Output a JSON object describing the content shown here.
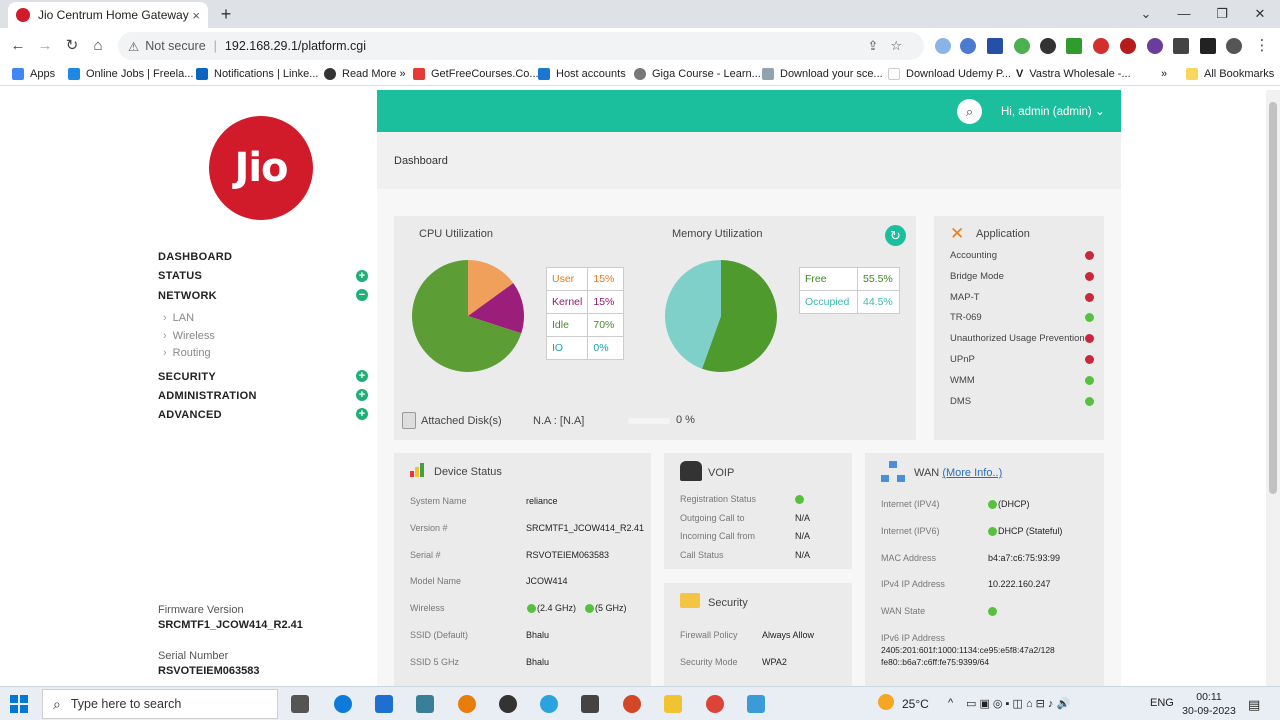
{
  "browser": {
    "tab_title": "Jio Centrum Home Gateway :",
    "tab_close": "×",
    "new_tab": "+",
    "security_label": "Not secure",
    "url": "192.168.29.1/platform.cgi",
    "bookmarks": [
      "Apps",
      "Online Jobs | Freela...",
      "Notifications | Linke...",
      "Read More »",
      "GetFreeCourses.Co...",
      "Host accounts",
      "Giga Course - Learn...",
      "Download your sce...",
      "Download Udemy P...",
      "Vastra Wholesale -...",
      "»",
      "All Bookmarks"
    ]
  },
  "sidebar": {
    "logo_text": "Jio",
    "menu": [
      {
        "label": "DASHBOARD",
        "toggle": ""
      },
      {
        "label": "STATUS",
        "toggle": "+"
      },
      {
        "label": "NETWORK",
        "toggle": "−"
      },
      {
        "label": "SECURITY",
        "toggle": "+"
      },
      {
        "label": "ADMINISTRATION",
        "toggle": "+"
      },
      {
        "label": "ADVANCED",
        "toggle": "+"
      }
    ],
    "network_submenu": [
      "LAN",
      "Wireless",
      "Routing"
    ],
    "firmware_label": "Firmware Version",
    "firmware_value": "SRCMTF1_JCOW414_R2.41",
    "serial_label": "Serial Number",
    "serial_value": "RSVOTEIEM063583"
  },
  "header": {
    "user": "Hi, admin (admin)",
    "breadcrumb": "Dashboard"
  },
  "cpu": {
    "title": "CPU Utilization",
    "rows": [
      {
        "label": "User",
        "value": "15%"
      },
      {
        "label": "Kernel",
        "value": "15%"
      },
      {
        "label": "Idle",
        "value": "70%"
      },
      {
        "label": "IO",
        "value": "0%"
      }
    ],
    "colors": {
      "user": "#f0a05a",
      "kernel": "#9b1f7a",
      "idle": "#5c9e35",
      "io": "#1aa3a3"
    }
  },
  "memory": {
    "title": "Memory Utilization",
    "rows": [
      {
        "label": "Free",
        "value": "55.5%"
      },
      {
        "label": "Occupied",
        "value": "44.5%"
      }
    ],
    "colors": {
      "free": "#4f9a2d",
      "occupied": "#7fd0c8"
    }
  },
  "disk": {
    "label": "Attached Disk(s)",
    "value": "N.A : [N.A]",
    "percent": "0 %"
  },
  "application": {
    "title": "Application",
    "items": [
      {
        "name": "Accounting",
        "status": "err"
      },
      {
        "name": "Bridge Mode",
        "status": "err"
      },
      {
        "name": "MAP-T",
        "status": "err"
      },
      {
        "name": "TR-069",
        "status": "ok"
      },
      {
        "name": "Unauthorized Usage Prevention",
        "status": "err"
      },
      {
        "name": "UPnP",
        "status": "err"
      },
      {
        "name": "WMM",
        "status": "ok"
      },
      {
        "name": "DMS",
        "status": "ok"
      }
    ]
  },
  "device_status": {
    "title": "Device Status",
    "rows": [
      {
        "label": "System Name",
        "value": "reliance"
      },
      {
        "label": "Version #",
        "value": "SRCMTF1_JCOW414_R2.41"
      },
      {
        "label": "Serial #",
        "value": "RSVOTEIEM063583"
      },
      {
        "label": "Model Name",
        "value": "JCOW414"
      },
      {
        "label": "Wireless",
        "value": "(2.4 GHz)",
        "value2": "(5 GHz)"
      },
      {
        "label": "SSID (Default)",
        "value": "Bhalu"
      },
      {
        "label": "SSID 5 GHz",
        "value": "Bhalu"
      }
    ]
  },
  "voip": {
    "title": "VOIP",
    "rows": [
      {
        "label": "Registration Status",
        "value": ""
      },
      {
        "label": "Outgoing Call to",
        "value": "N/A"
      },
      {
        "label": "Incoming Call from",
        "value": "N/A"
      },
      {
        "label": "Call Status",
        "value": "N/A"
      }
    ]
  },
  "security": {
    "title": "Security",
    "rows": [
      {
        "label": "Firewall Policy",
        "value": "Always Allow"
      },
      {
        "label": "Security Mode",
        "value": "WPA2"
      }
    ]
  },
  "wan": {
    "title": "WAN",
    "more": "(More Info..)",
    "rows": [
      {
        "label": "Internet (IPV4)",
        "value": "(DHCP)"
      },
      {
        "label": "Internet (IPV6)",
        "value": "DHCP (Stateful)"
      },
      {
        "label": "MAC Address",
        "value": "b4:a7:c6:75:93:99"
      },
      {
        "label": "IPv4 IP Address",
        "value": "10.222.160.247"
      },
      {
        "label": "WAN State",
        "value": ""
      }
    ],
    "ipv6_label": "IPv6 IP Address",
    "ipv6_line1": "2405:201:601f:1000:1134:ce95:e5f8:47a2/128",
    "ipv6_line2": "fe80::b6a7:c6ff:fe75:9399/64"
  },
  "taskbar": {
    "search_placeholder": "Type here to search",
    "temperature": "25°C",
    "language": "ENG",
    "time": "00:11",
    "date": "30-09-2023"
  }
}
